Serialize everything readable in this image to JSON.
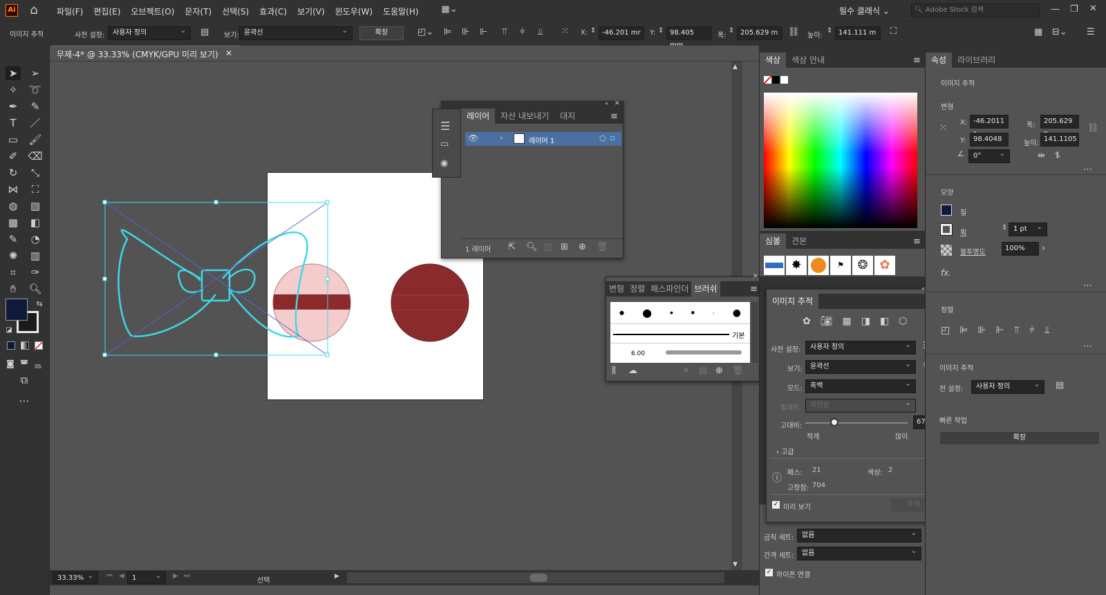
{
  "app": {
    "logo": "Ai",
    "menus": [
      "파일(F)",
      "편집(E)",
      "오브젝트(O)",
      "문자(T)",
      "선택(S)",
      "효과(C)",
      "보기(V)",
      "윈도우(W)",
      "도움말(H)"
    ],
    "workspace": "필수 클래식",
    "stock_placeholder": "Adobe Stock 검색"
  },
  "control": {
    "context": "이미지 추적",
    "preset_label": "사전 설정:",
    "preset_value": "사용자 정의",
    "view_label": "보기:",
    "view_value": "윤곽선",
    "expand_label": "확장",
    "x_label": "X:",
    "x_value": "-46.201 mr",
    "y_label": "Y:",
    "y_value": "98.405 mm",
    "w_label": "폭:",
    "w_value": "205.629 m",
    "h_label": "높이:",
    "h_value": "141.111 m"
  },
  "document": {
    "tab_title": "무제-4* @ 33.33% (CMYK/GPU 미리 보기)",
    "zoom": "33.33%",
    "artboard_num": "1",
    "status": "선택"
  },
  "layers_panel": {
    "tabs": [
      "레이어",
      "자산 내보내기",
      "대지"
    ],
    "layer_name": "레이어 1",
    "footer_count": "1 레이어"
  },
  "brushes_panel": {
    "tabs": [
      "변형",
      "정렬",
      "패스파인더",
      "브러쉬"
    ],
    "basic_label": "기본",
    "size_label": "6.00"
  },
  "color_panel": {
    "tabs": [
      "색상",
      "색상 안내"
    ],
    "symbol_tabs": [
      "심볼",
      "견본"
    ]
  },
  "trace_panel": {
    "title": "이미지 추적",
    "preset_label": "사전 설정:",
    "preset_value": "사용자 정의",
    "view_label": "보기:",
    "view_value": "윤곽선",
    "mode_label": "모드:",
    "mode_value": "흑백",
    "palette_label": "팔레트:",
    "palette_value": "제한됨",
    "threshold_label": "고대비:",
    "threshold_value": "67",
    "less_label": "적게",
    "more_label": "많이",
    "advanced_label": "고급",
    "paths_label": "패스:",
    "paths_value": "21",
    "colors_label": "색상:",
    "colors_value": "2",
    "anchors_label": "고정점:",
    "anchors_value": "704",
    "preview_label": "미리 보기",
    "trace_button": "추적"
  },
  "properties_panel": {
    "tabs": [
      "속성",
      "라이브러리"
    ],
    "context": "이미지 추적",
    "transform_label": "변형",
    "x_label": "X:",
    "x_value": "-46.2011 r",
    "y_label": "Y:",
    "y_value": "98.4048 m",
    "w_label": "폭:",
    "w_value": "205.629 n",
    "h_label": "높이:",
    "h_value": "141.1105",
    "angle_value": "0°",
    "appearance_label": "모양",
    "fill_label": "칠",
    "stroke_label": "획",
    "stroke_value": "1 pt",
    "opacity_label": "불투명도",
    "opacity_value": "100%",
    "fx_label": "fx.",
    "align_label": "정렬",
    "trace_label": "이미지 추적",
    "trace_preset_label": "전 설정:",
    "trace_preset_value": "사용자 정의",
    "quick_actions_label": "빠른 작업",
    "expand_button": "확장"
  },
  "char_panel": {
    "kinsoku_label": "금칙 세트:",
    "kinsoku_value": "없음",
    "mojikumi_label": "간격 세트:",
    "mojikumi_value": "없음",
    "hyphen_label": "하이픈 연결"
  },
  "colors": {
    "fill": "#0f1a3a",
    "artwork_red": "#8b2a2a",
    "artwork_pink": "#f4cccc",
    "selection": "#3ed8e8"
  }
}
